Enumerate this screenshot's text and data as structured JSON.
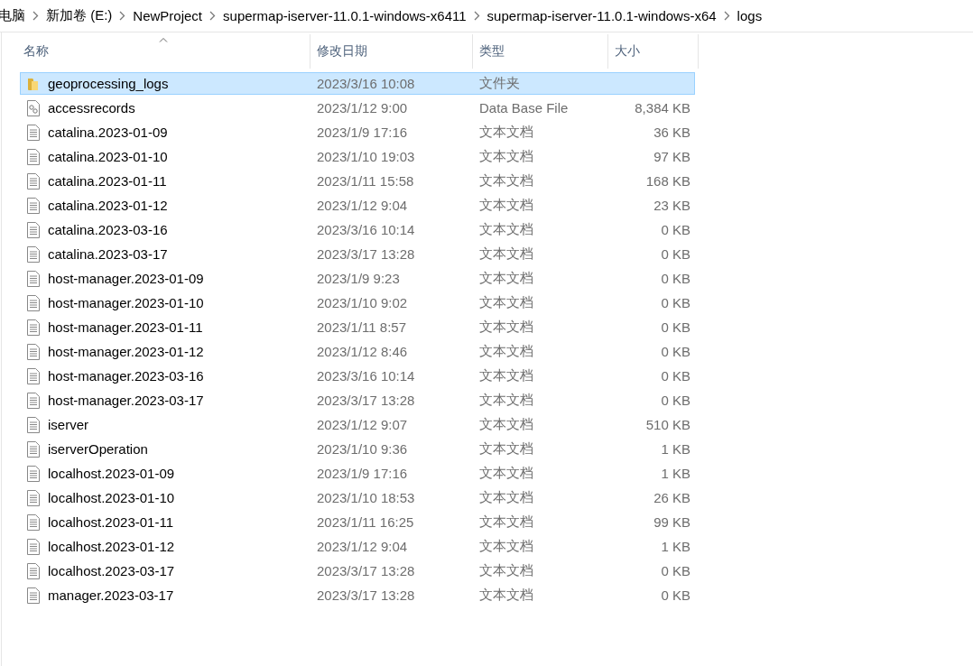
{
  "breadcrumb": [
    "电脑",
    "新加卷 (E:)",
    "NewProject",
    "supermap-iserver-11.0.1-windows-x6411",
    "supermap-iserver-11.0.1-windows-x64",
    "logs"
  ],
  "columns": [
    "名称",
    "修改日期",
    "类型",
    "大小"
  ],
  "rows": [
    {
      "kind": "folder",
      "name": "geoprocessing_logs",
      "date": "2023/3/16 10:08",
      "type": "文件夹",
      "selected": true
    },
    {
      "kind": "database",
      "name": "accessrecords",
      "date": "2023/1/12 9:00",
      "type": "Data Base File",
      "size": "8,384 KB",
      "selected": false
    },
    {
      "kind": "text",
      "name": "catalina.2023-01-09",
      "date": "2023/1/9 17:16",
      "type": "文本文档",
      "size": "36 KB",
      "selected": false
    },
    {
      "kind": "text",
      "name": "catalina.2023-01-10",
      "date": "2023/1/10 19:03",
      "type": "文本文档",
      "size": "97 KB",
      "selected": false
    },
    {
      "kind": "text",
      "name": "catalina.2023-01-11",
      "date": "2023/1/11 15:58",
      "type": "文本文档",
      "size": "168 KB",
      "selected": false
    },
    {
      "kind": "text",
      "name": "catalina.2023-01-12",
      "date": "2023/1/12 9:04",
      "type": "文本文档",
      "size": "23 KB",
      "selected": false
    },
    {
      "kind": "text",
      "name": "catalina.2023-03-16",
      "date": "2023/3/16 10:14",
      "type": "文本文档",
      "size": "0 KB",
      "selected": false
    },
    {
      "kind": "text",
      "name": "catalina.2023-03-17",
      "date": "2023/3/17 13:28",
      "type": "文本文档",
      "size": "0 KB",
      "selected": false
    },
    {
      "kind": "text",
      "name": "host-manager.2023-01-09",
      "date": "2023/1/9 9:23",
      "type": "文本文档",
      "size": "0 KB",
      "selected": false
    },
    {
      "kind": "text",
      "name": "host-manager.2023-01-10",
      "date": "2023/1/10 9:02",
      "type": "文本文档",
      "size": "0 KB",
      "selected": false
    },
    {
      "kind": "text",
      "name": "host-manager.2023-01-11",
      "date": "2023/1/11 8:57",
      "type": "文本文档",
      "size": "0 KB",
      "selected": false
    },
    {
      "kind": "text",
      "name": "host-manager.2023-01-12",
      "date": "2023/1/12 8:46",
      "type": "文本文档",
      "size": "0 KB",
      "selected": false
    },
    {
      "kind": "text",
      "name": "host-manager.2023-03-16",
      "date": "2023/3/16 10:14",
      "type": "文本文档",
      "size": "0 KB",
      "selected": false
    },
    {
      "kind": "text",
      "name": "host-manager.2023-03-17",
      "date": "2023/3/17 13:28",
      "type": "文本文档",
      "size": "0 KB",
      "selected": false
    },
    {
      "kind": "text",
      "name": "iserver",
      "date": "2023/1/12 9:07",
      "type": "文本文档",
      "size": "510 KB",
      "selected": false
    },
    {
      "kind": "text",
      "name": "iserverOperation",
      "date": "2023/1/10 9:36",
      "type": "文本文档",
      "size": "1 KB",
      "selected": false
    },
    {
      "kind": "text",
      "name": "localhost.2023-01-09",
      "date": "2023/1/9 17:16",
      "type": "文本文档",
      "size": "1 KB",
      "selected": false
    },
    {
      "kind": "text",
      "name": "localhost.2023-01-10",
      "date": "2023/1/10 18:53",
      "type": "文本文档",
      "size": "26 KB",
      "selected": false
    },
    {
      "kind": "text",
      "name": "localhost.2023-01-11",
      "date": "2023/1/11 16:25",
      "type": "文本文档",
      "size": "99 KB",
      "selected": false
    },
    {
      "kind": "text",
      "name": "localhost.2023-01-12",
      "date": "2023/1/12 9:04",
      "type": "文本文档",
      "size": "1 KB",
      "selected": false
    },
    {
      "kind": "text",
      "name": "localhost.2023-03-17",
      "date": "2023/3/17 13:28",
      "type": "文本文档",
      "size": "0 KB",
      "selected": false
    },
    {
      "kind": "text",
      "name": "manager.2023-03-17",
      "date": "2023/3/17 13:28",
      "type": "文本文档",
      "size": "0 KB",
      "selected": false
    }
  ]
}
